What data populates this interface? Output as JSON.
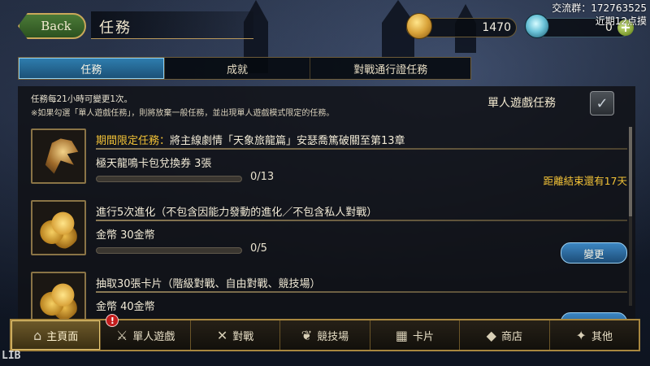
{
  "header": {
    "back_label": "Back",
    "title": "任務",
    "gold": "1470",
    "crystal": "0",
    "plus": "+"
  },
  "overlay": {
    "group_line": "交流群：172763525",
    "note_line": "近期12点摸"
  },
  "tabs": [
    {
      "label": "任務",
      "active": true
    },
    {
      "label": "成就",
      "active": false
    },
    {
      "label": "對戰通行證任務",
      "active": false
    }
  ],
  "panel": {
    "info_line1": "任務每21小時可變更1次。",
    "info_line2": "※如果勾選「單人遊戲任務」，則將放棄一般任務，並出現單人遊戲模式限定的任務。",
    "single_mode_label": "單人遊戲任務",
    "missions": [
      {
        "title_highlight": "期間限定任務：",
        "title": "將主線劇情「天象旅龍篇」安瑟喬篤破關至第13章",
        "reward": "極天龍鳴卡包兌換券 3張",
        "progress_text": "0/13",
        "progress": 0,
        "deadline": "距離結束還有17天",
        "icon": "dragon-icon"
      },
      {
        "title_highlight": "",
        "title": "進行5次進化（不包含因能力發動的進化／不包含私人對戰）",
        "reward": "金幣 30金幣",
        "progress_text": "0/5",
        "progress": 0,
        "button_label": "變更",
        "icon": "gold-coins-icon"
      },
      {
        "title_highlight": "",
        "title": "抽取30張卡片（階級對戰、自由對戰、競技場）",
        "reward": "金幣 40金幣",
        "icon": "gold-coins-icon"
      }
    ]
  },
  "nav": [
    {
      "label": "主頁面",
      "icon": "home-icon",
      "glyph": "⌂",
      "active": true
    },
    {
      "label": "單人遊戲",
      "icon": "sword-icon",
      "glyph": "⚔",
      "badge": "!"
    },
    {
      "label": "對戰",
      "icon": "crossed-swords-icon",
      "glyph": "✕"
    },
    {
      "label": "競技場",
      "icon": "laurel-icon",
      "glyph": "❦"
    },
    {
      "label": "卡片",
      "icon": "cards-icon",
      "glyph": "▦"
    },
    {
      "label": "商店",
      "icon": "shop-icon",
      "glyph": "◆"
    },
    {
      "label": "其他",
      "icon": "other-icon",
      "glyph": "✦"
    }
  ],
  "watermark": "LIB"
}
